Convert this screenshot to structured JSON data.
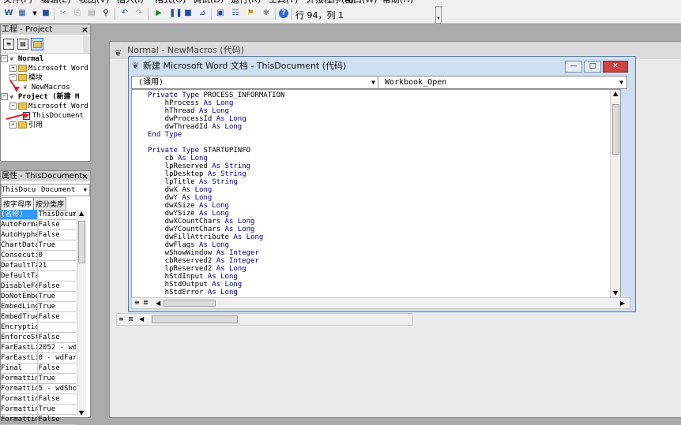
{
  "menubar": {
    "items": [
      "文件(F)",
      "编辑(E)",
      "视图(V)",
      "插入(I)",
      "格式(O)",
      "调试(D)",
      "运行(R)",
      "工具(T)",
      "外接程序(A)",
      "窗口(W)",
      "帮助(H)"
    ]
  },
  "toolbar": {
    "icons": [
      "word-icon",
      "insert-dropdown-icon",
      "save-icon",
      "cut-icon",
      "copy-icon",
      "paste-icon",
      "find-icon",
      "undo-icon",
      "redo-icon",
      "run-icon",
      "break-icon",
      "reset-icon",
      "design-mode-icon",
      "project-explorer-icon",
      "properties-icon",
      "object-browser-icon",
      "toolbox-icon",
      "help-icon"
    ],
    "cursor_position": "行 94，列 1"
  },
  "project_pane": {
    "title": "工程 - Project",
    "close": "×",
    "view_code_icon": "view-code-icon",
    "view_object_icon": "view-object-icon",
    "toggle_folders_icon": "toggle-folders-icon",
    "tree": [
      {
        "label": "Normal",
        "level": 0
      },
      {
        "label": "Microsoft Word",
        "level": 1
      },
      {
        "label": "模块",
        "level": 1
      },
      {
        "label": "NewMacros",
        "level": 2
      },
      {
        "label": "Project (新建 M",
        "level": 0
      },
      {
        "label": "Microsoft Word",
        "level": 1
      },
      {
        "label": "ThisDocument",
        "level": 2
      },
      {
        "label": "引用",
        "level": 1
      }
    ]
  },
  "properties_pane": {
    "title": "属性 - ThisDocument",
    "close": "×",
    "object_name": "ThisDocu",
    "object_type": "Document",
    "tabs": [
      "按字母序",
      "按分类序"
    ],
    "rows": [
      {
        "name": "(名称)",
        "value": "ThisDocum"
      },
      {
        "name": "AutoFormat",
        "value": "False"
      },
      {
        "name": "AutoHyphen",
        "value": "False"
      },
      {
        "name": "ChartDataP",
        "value": "True"
      },
      {
        "name": "Consecutiv",
        "value": "0"
      },
      {
        "name": "DefaultTab",
        "value": "21"
      },
      {
        "name": "DefaultTar",
        "value": ""
      },
      {
        "name": "DisableFea",
        "value": "False"
      },
      {
        "name": "DoNotEmbed",
        "value": "True"
      },
      {
        "name": "EmbedLingu",
        "value": "True"
      },
      {
        "name": "EmbedTrueT",
        "value": "False"
      },
      {
        "name": "Encryption",
        "value": ""
      },
      {
        "name": "EnforceSty",
        "value": "False"
      },
      {
        "name": "FarEastLin",
        "value": "2052 - wd"
      },
      {
        "name": "FarEastLin",
        "value": "0 - wdFar"
      },
      {
        "name": "Final",
        "value": "False"
      },
      {
        "name": "Formatting",
        "value": "True"
      },
      {
        "name": "Formatting",
        "value": "5 - wdSho"
      },
      {
        "name": "Formatting",
        "value": "False"
      },
      {
        "name": "Formatting",
        "value": "True"
      },
      {
        "name": "Formatting",
        "value": "False"
      }
    ]
  },
  "window_normal": {
    "title": "Normal - NewMacros (代码)"
  },
  "window_doc": {
    "title": "新建 Microsoft Word 文档 - ThisDocument (代码)",
    "minimize": "—",
    "maximize": "□",
    "close": "✕",
    "object_combo": "(通用)",
    "proc_combo": "Workbook_Open"
  },
  "code": [
    [
      {
        "k": 1,
        "t": "Private Type "
      },
      {
        "k": 0,
        "t": "PROCESS_INFORMATION"
      }
    ],
    [
      {
        "k": 0,
        "t": "    hProcess "
      },
      {
        "k": 1,
        "t": "As Long"
      }
    ],
    [
      {
        "k": 0,
        "t": "    hThread "
      },
      {
        "k": 1,
        "t": "As Long"
      }
    ],
    [
      {
        "k": 0,
        "t": "    dwProcessId "
      },
      {
        "k": 1,
        "t": "As Long"
      }
    ],
    [
      {
        "k": 0,
        "t": "    dwThreadId "
      },
      {
        "k": 1,
        "t": "As Long"
      }
    ],
    [
      {
        "k": 1,
        "t": "End Type"
      }
    ],
    [
      {
        "k": 0,
        "t": ""
      }
    ],
    [
      {
        "k": 1,
        "t": "Private Type "
      },
      {
        "k": 0,
        "t": "STARTUPINFO"
      }
    ],
    [
      {
        "k": 0,
        "t": "    cb "
      },
      {
        "k": 1,
        "t": "As Long"
      }
    ],
    [
      {
        "k": 0,
        "t": "    lpReserved "
      },
      {
        "k": 1,
        "t": "As String"
      }
    ],
    [
      {
        "k": 0,
        "t": "    lpDesktop "
      },
      {
        "k": 1,
        "t": "As String"
      }
    ],
    [
      {
        "k": 0,
        "t": "    lpTitle "
      },
      {
        "k": 1,
        "t": "As String"
      }
    ],
    [
      {
        "k": 0,
        "t": "    dwX "
      },
      {
        "k": 1,
        "t": "As Long"
      }
    ],
    [
      {
        "k": 0,
        "t": "    dwY "
      },
      {
        "k": 1,
        "t": "As Long"
      }
    ],
    [
      {
        "k": 0,
        "t": "    dwXSize "
      },
      {
        "k": 1,
        "t": "As Long"
      }
    ],
    [
      {
        "k": 0,
        "t": "    dwYSize "
      },
      {
        "k": 1,
        "t": "As Long"
      }
    ],
    [
      {
        "k": 0,
        "t": "    dwXCountChars "
      },
      {
        "k": 1,
        "t": "As Long"
      }
    ],
    [
      {
        "k": 0,
        "t": "    dwYCountChars "
      },
      {
        "k": 1,
        "t": "As Long"
      }
    ],
    [
      {
        "k": 0,
        "t": "    dwFillAttribute "
      },
      {
        "k": 1,
        "t": "As Long"
      }
    ],
    [
      {
        "k": 0,
        "t": "    dwFlags "
      },
      {
        "k": 1,
        "t": "As Long"
      }
    ],
    [
      {
        "k": 0,
        "t": "    wShowWindow "
      },
      {
        "k": 1,
        "t": "As Integer"
      }
    ],
    [
      {
        "k": 0,
        "t": "    cbReserved2 "
      },
      {
        "k": 1,
        "t": "As Integer"
      }
    ],
    [
      {
        "k": 0,
        "t": "    lpReserved2 "
      },
      {
        "k": 1,
        "t": "As Long"
      }
    ],
    [
      {
        "k": 0,
        "t": "    hStdInput "
      },
      {
        "k": 1,
        "t": "As Long"
      }
    ],
    [
      {
        "k": 0,
        "t": "    hStdOutput "
      },
      {
        "k": 1,
        "t": "As Long"
      }
    ],
    [
      {
        "k": 0,
        "t": "    hStdError "
      },
      {
        "k": 1,
        "t": "As Long"
      }
    ]
  ],
  "colors": {
    "keyword": "#00008b",
    "annotation_arrow": "#e02020"
  }
}
